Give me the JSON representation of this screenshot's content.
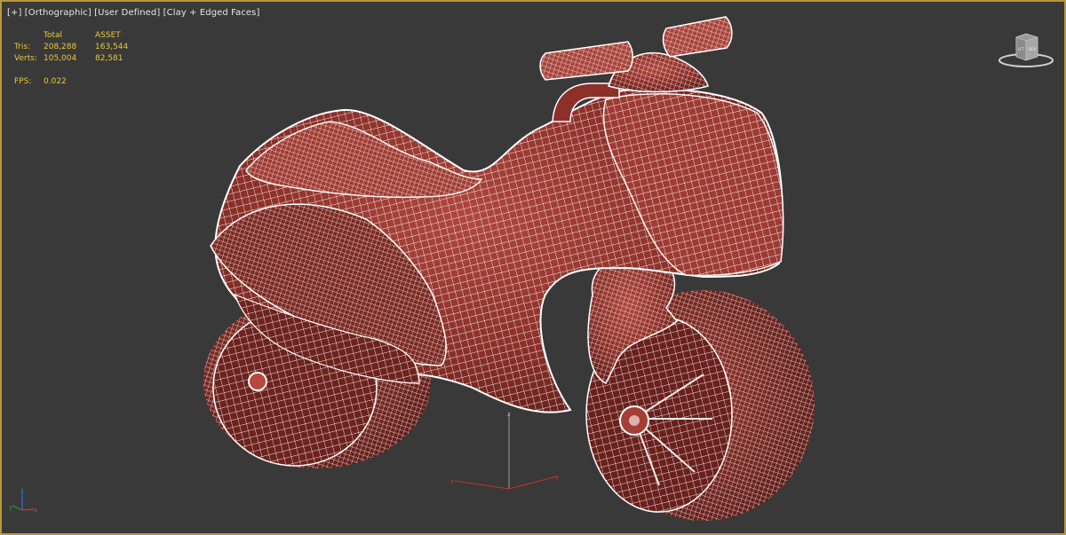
{
  "viewport": {
    "label_plus": "[+]",
    "label_view": "[Orthographic]",
    "label_camera": "[User Defined]",
    "label_shading": "[Clay + Edged Faces]"
  },
  "stats": {
    "header_total": "Total",
    "header_asset": "ASSET",
    "tris_label": "Tris:",
    "tris_total": "208,288",
    "tris_asset": "163,544",
    "verts_label": "Verts:",
    "verts_total": "105,004",
    "verts_asset": "82,581",
    "fps_label": "FPS:",
    "fps_value": "0.022"
  },
  "viewcube": {
    "left_face": "LFT",
    "right_face": "BCK"
  },
  "axes": {
    "x": "x",
    "y": "y",
    "z": "z"
  },
  "colors": {
    "background": "#393939",
    "border": "#b69a3c",
    "stats_text": "#e8c83a",
    "clay": "#8a2f28",
    "wire": "#ffffff"
  }
}
